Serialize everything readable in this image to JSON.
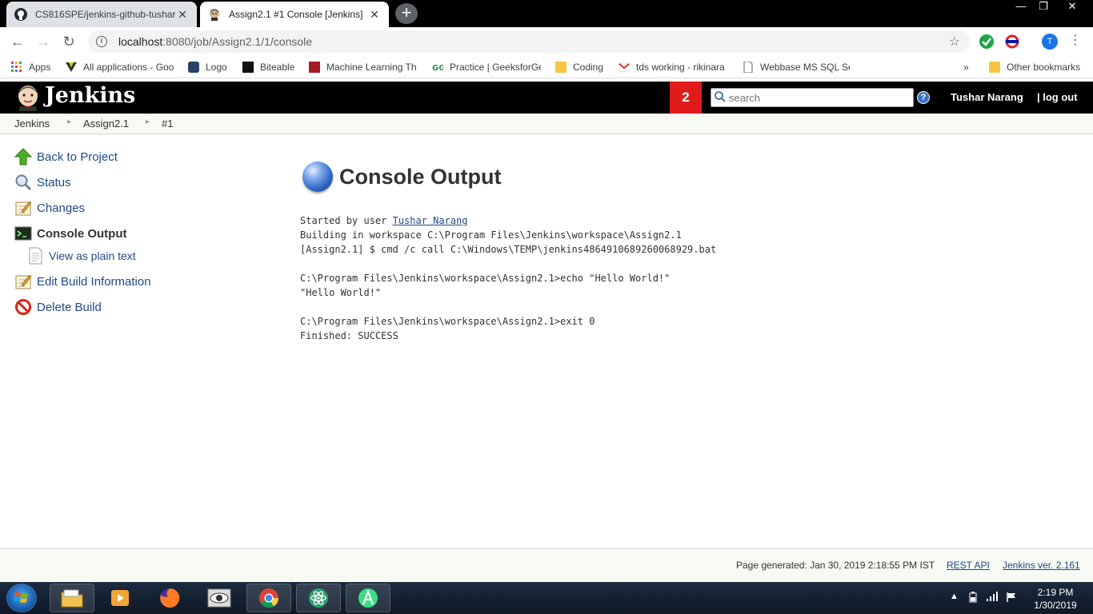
{
  "browser": {
    "tabs": [
      {
        "title": "CS816SPE/jenkins-github-tushar-",
        "active": false
      },
      {
        "title": "Assign2.1 #1 Console [Jenkins]",
        "active": true
      }
    ],
    "url_host": "localhost",
    "url_path": ":8080/job/Assign2.1/1/console",
    "profile_initial": "T",
    "bookmarks": [
      {
        "label": "Apps",
        "icon": "apps-grid-icon"
      },
      {
        "label": "All applications - Goo",
        "icon": "v-logo-icon"
      },
      {
        "label": "Logo",
        "icon": "logo-icon"
      },
      {
        "label": "Biteable",
        "icon": "biteable-icon"
      },
      {
        "label": "Machine Learning Th",
        "icon": "m-logo-icon"
      },
      {
        "label": "Practice | GeeksforGe",
        "icon": "geeksforgeeks-icon"
      },
      {
        "label": "Coding",
        "icon": "folder-icon"
      },
      {
        "label": "tds working - rikinara",
        "icon": "gmail-icon"
      },
      {
        "label": "Webbase MS SQL Se",
        "icon": "page-icon"
      }
    ],
    "bookmarks_more": "»",
    "other_bookmarks": "Other bookmarks"
  },
  "jenkins": {
    "logo_text": "Jenkins",
    "notification_count": "2",
    "search_placeholder": "search",
    "user": "Tushar Narang",
    "logout": "| log out",
    "breadcrumbs": [
      "Jenkins",
      "Assign2.1",
      "#1"
    ],
    "side_tasks": [
      {
        "label": "Back to Project",
        "icon": "up-arrow-icon"
      },
      {
        "label": "Status",
        "icon": "magnifier-icon"
      },
      {
        "label": "Changes",
        "icon": "notepad-icon"
      },
      {
        "label": "Console Output",
        "icon": "terminal-icon",
        "current": true
      },
      {
        "label": "View as plain text",
        "icon": "document-icon",
        "sub": true
      },
      {
        "label": "Edit Build Information",
        "icon": "notepad-icon"
      },
      {
        "label": "Delete Build",
        "icon": "no-entry-icon"
      }
    ],
    "page_title": "Console Output",
    "console": {
      "line1_prefix": "Started by user ",
      "line1_user": "Tushar Narang",
      "rest": "Building in workspace C:\\Program Files\\Jenkins\\workspace\\Assign2.1\n[Assign2.1] $ cmd /c call C:\\Windows\\TEMP\\jenkins4864910689260068929.bat\n\nC:\\Program Files\\Jenkins\\workspace\\Assign2.1>echo \"Hello World!\"\n\"Hello World!\"\n\nC:\\Program Files\\Jenkins\\workspace\\Assign2.1>exit 0\nFinished: SUCCESS"
    },
    "footer": {
      "generated": "Page generated: Jan 30, 2019 2:18:55 PM IST",
      "rest_api": "REST API",
      "version": "Jenkins ver. 2.161"
    }
  },
  "taskbar": {
    "time": "2:19 PM",
    "date": "1/30/2019"
  },
  "colors": {
    "jenkins_header": "#000000",
    "notification_badge": "#e01b1b",
    "link": "#204a87",
    "breadcrumb_bg": "#f6faf2"
  }
}
